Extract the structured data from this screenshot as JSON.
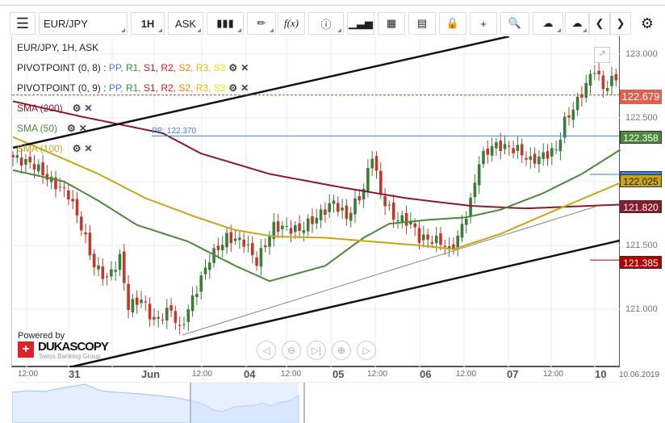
{
  "toolbar": {
    "menu_icon": "hamburger-icon",
    "symbol": "EUR/JPY",
    "timeframe": "1H",
    "side": "ASK",
    "fx_label": "f(x)"
  },
  "chart": {
    "title": "EUR/JPY, 1H, ASK",
    "indicators": [
      {
        "name": "PIVOTPOINT (0, 8)",
        "sep": " : ",
        "levels": [
          "PP",
          "R1",
          "S1",
          "R2",
          "S2",
          "R3",
          "S3"
        ]
      },
      {
        "name": "PIVOTPOINT (0, 9)",
        "sep": " : ",
        "levels": [
          "PP",
          "R1",
          "S1",
          "R2",
          "S2",
          "R3",
          "S3"
        ]
      }
    ],
    "level_colors": [
      "#3a7ee8",
      "#2e8b2e",
      "#b22222",
      "#ee1111",
      "#ff7f00",
      "#f0b400",
      "#f0e000"
    ],
    "sma": [
      {
        "label": "SMA (200)",
        "color": "#8b1a2b"
      },
      {
        "label": "SMA (50)",
        "color": "#4a8a3a"
      },
      {
        "label": "SMA (100)",
        "color": "#c9a516"
      }
    ],
    "pp_label": "PP: 122.370",
    "price_ticks": [
      "123.000",
      "122.500",
      "121.500",
      "121.000"
    ],
    "price_labels": {
      "current": "122.679",
      "pp": "122.358",
      "sma100": "122.025",
      "sma200": "121.820",
      "s1": "121.385"
    },
    "x_ticks": [
      "12:00",
      "31",
      "Jun",
      "12:00",
      "04",
      "12:00",
      "05",
      "12:00",
      "06",
      "12:00",
      "07",
      "12:00",
      "10"
    ],
    "date_label": "10.06.2019",
    "branding": {
      "powered": "Powered by",
      "name": "DUKASCOPY",
      "sub": "Swiss Banking Group"
    },
    "price_path": [
      [
        0,
        122.19
      ],
      [
        5,
        122.13
      ],
      [
        9,
        122.0
      ],
      [
        13,
        121.9
      ],
      [
        16,
        121.65
      ],
      [
        19,
        121.34
      ],
      [
        22,
        121.24
      ],
      [
        25,
        121.4
      ],
      [
        27,
        121.02
      ],
      [
        30,
        121.08
      ],
      [
        33,
        120.9
      ],
      [
        37,
        121.0
      ],
      [
        39,
        120.83
      ],
      [
        42,
        121.08
      ],
      [
        46,
        121.4
      ],
      [
        50,
        121.56
      ],
      [
        54,
        121.53
      ],
      [
        57,
        121.37
      ],
      [
        61,
        121.65
      ],
      [
        67,
        121.62
      ],
      [
        71,
        121.72
      ],
      [
        75,
        121.84
      ],
      [
        78,
        121.72
      ],
      [
        82,
        121.94
      ],
      [
        84,
        122.22
      ],
      [
        86,
        121.9
      ],
      [
        89,
        121.72
      ],
      [
        93,
        121.68
      ],
      [
        95,
        121.56
      ],
      [
        100,
        121.53
      ],
      [
        102,
        121.46
      ],
      [
        104,
        121.56
      ],
      [
        107,
        121.84
      ],
      [
        109,
        122.16
      ],
      [
        112,
        122.28
      ],
      [
        114,
        122.28
      ],
      [
        118,
        122.25
      ],
      [
        121,
        122.16
      ],
      [
        127,
        122.25
      ],
      [
        129,
        122.47
      ],
      [
        132,
        122.63
      ],
      [
        136,
        122.89
      ],
      [
        138,
        122.73
      ],
      [
        141,
        122.82
      ]
    ],
    "sma200_path": [
      [
        0,
        122.63
      ],
      [
        16,
        122.51
      ],
      [
        35,
        122.38
      ],
      [
        44,
        122.22
      ],
      [
        60,
        122.06
      ],
      [
        76,
        121.96
      ],
      [
        92,
        121.87
      ],
      [
        107,
        121.81
      ],
      [
        120,
        121.79
      ],
      [
        142,
        121.82
      ]
    ],
    "sma50_path": [
      [
        0,
        122.09
      ],
      [
        12,
        122.0
      ],
      [
        20,
        121.85
      ],
      [
        29,
        121.66
      ],
      [
        41,
        121.53
      ],
      [
        52,
        121.34
      ],
      [
        60,
        121.22
      ],
      [
        73,
        121.34
      ],
      [
        82,
        121.56
      ],
      [
        88,
        121.67
      ],
      [
        97,
        121.7
      ],
      [
        106,
        121.72
      ],
      [
        114,
        121.78
      ],
      [
        124,
        121.91
      ],
      [
        133,
        122.06
      ],
      [
        142,
        122.25
      ]
    ],
    "sma100_path": [
      [
        0,
        122.35
      ],
      [
        9,
        122.22
      ],
      [
        20,
        122.06
      ],
      [
        31,
        121.87
      ],
      [
        43,
        121.72
      ],
      [
        52,
        121.62
      ],
      [
        61,
        121.57
      ],
      [
        73,
        121.56
      ],
      [
        84,
        121.53
      ],
      [
        95,
        121.5
      ],
      [
        103,
        121.47
      ],
      [
        114,
        121.59
      ],
      [
        125,
        121.75
      ],
      [
        142,
        121.99
      ]
    ]
  }
}
